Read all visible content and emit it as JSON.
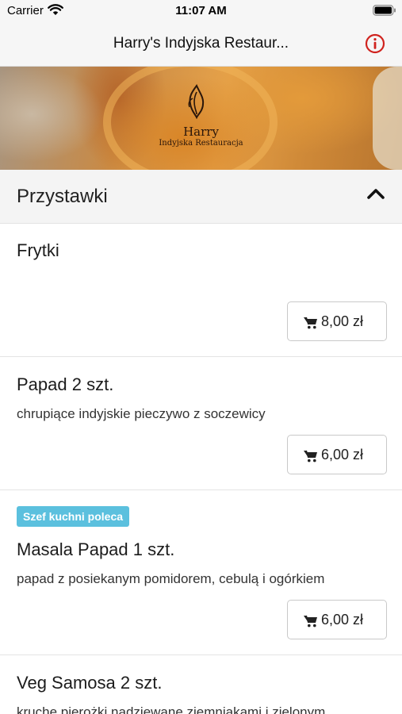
{
  "status_bar": {
    "carrier": "Carrier",
    "time": "11:07 AM"
  },
  "nav": {
    "title": "Harry's Indyjska Restaur...",
    "info_icon": "info-icon",
    "accent_color": "#d0231e"
  },
  "hero": {
    "logo_name": "Harry",
    "logo_subtitle": "Indyjska Restauracja"
  },
  "section": {
    "title": "Przystawki",
    "toggle_icon": "chevron-up-icon"
  },
  "items": [
    {
      "name": "Frytki",
      "description": "",
      "price": "8,00 zł"
    },
    {
      "name": "Papad 2 szt.",
      "description": "chrupiące indyjskie pieczywo z soczewicy",
      "price": "6,00 zł"
    },
    {
      "name": "Masala Papad 1 szt.",
      "badge": "Szef kuchni poleca",
      "description": "papad z posiekanym pomidorem, cebulą i ogórkiem",
      "price": "6,00 zł"
    },
    {
      "name": "Veg Samosa 2 szt.",
      "description": "kruche pierożki nadziewane ziemniakami i zielonym"
    }
  ],
  "colors": {
    "badge_bg": "#5bc0de",
    "section_bg": "#f4f4f4",
    "nav_bg": "#f6f6f6"
  }
}
